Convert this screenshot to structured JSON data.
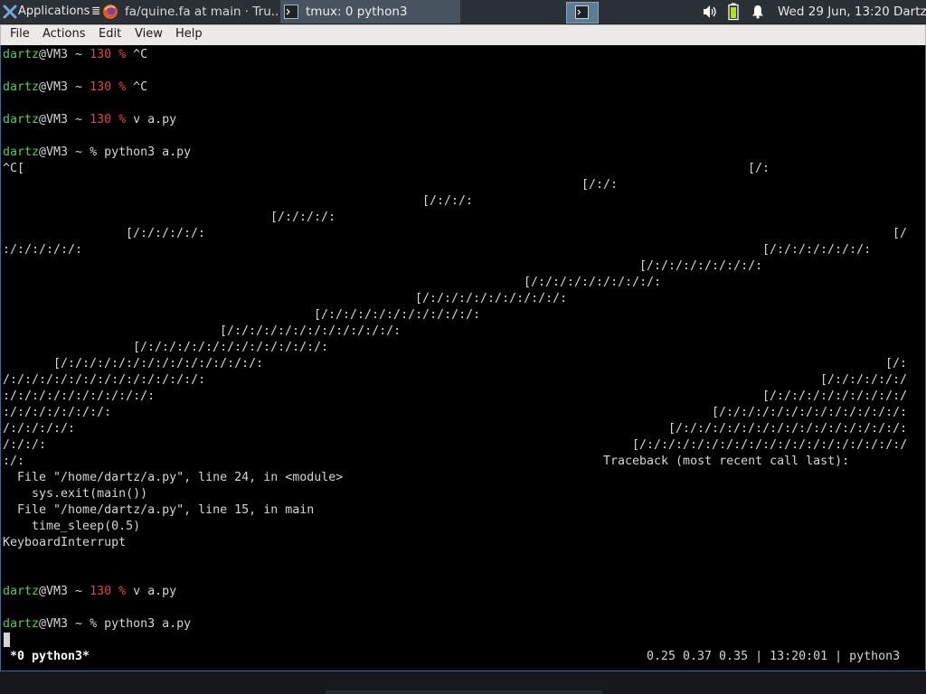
{
  "panel": {
    "apps_label": "Applications",
    "apps_suffix": "≣",
    "tasks": [
      {
        "label": "fa/quine.fa at main · Tru..."
      },
      {
        "label": "tmux: 0 python3"
      }
    ],
    "clock": "Wed 29 Jun, 13:20",
    "user": "Dartz"
  },
  "menu": {
    "items": [
      "File",
      "Actions",
      "Edit",
      "View",
      "Help"
    ]
  },
  "terminal": {
    "user": "dartz",
    "host": "@VM3 ~ ",
    "exit_code": "130",
    "pct": " %",
    "percent": "%",
    "lines": {
      "c1": " ^C",
      "c2": " ^C",
      "c3": " v a.py",
      "c4": " python3 a.py",
      "l_ctrl": "^C[",
      "r1": "[/:",
      "r2": "[/:/:",
      "r3": "[/:/:/:",
      "r4": "[/:/:/:/:",
      "r5": "[/:/:/:/:/:",
      "r5b": "[/",
      "r6a": ":/:/:/:/:/:",
      "r6b": "[/:/:/:/:/:/:/:",
      "r7": "[/:/:/:/:/:/:/:/:",
      "r8": "[/:/:/:/:/:/:/:/:/:",
      "r9": "[/:/:/:/:/:/:/:/:/:/:",
      "r10": "[/:/:/:/:/:/:/:/:/:/:/:",
      "r11": "[/:/:/:/:/:/:/:/:/:/:/:/:",
      "r12": "[/:/:/:/:/:/:/:/:/:/:/:/:/:",
      "r13": "[/:/:/:/:/:/:/:/:/:/:/:/:/:/:",
      "r13b": "[/:",
      "r14a": "/:/:/:/:/:/:/:/:/:/:/:/:/:/:",
      "r14b": "[/:/:/:/:/:/",
      "r15a": ":/:/:/:/:/:/:/:/:/:/:",
      "r15b": "[/:/:/:/:/:/:/:/:/:/",
      "r16a": ":/:/:/:/:/:/:/:",
      "r16b": "[/:/:/:/:/:/:/:/:/:/:/:/:/:",
      "r17a": "/:/:/:/:/:",
      "r17b": "[/:/:/:/:/:/:/:/:/:/:/:/:/:/:/:/:",
      "r18a": "/:/:/:",
      "r18b": "[/:/:/:/:/:/:/:/:/:/:/:/:/:/:/:/:/:/:/",
      "r19a": ":/:",
      "r19b": "Traceback (most recent call last):",
      "tb1": "  File \"/home/dartz/a.py\", line 24, in <module>",
      "tb2": "    sys.exit(main())",
      "tb3": "  File \"/home/dartz/a.py\", line 15, in main",
      "tb4": "    time_sleep(0.5)",
      "tb5": "KeyboardInterrupt",
      "c5": " v a.py",
      "c6": " python3 a.py"
    }
  },
  "status": {
    "window": "*0 python3*",
    "right": "0.25 0.37 0.35 | 13:20:01 | python3"
  },
  "colors": {
    "prompt_user": "#5cc75c",
    "exit_code": "#e0454d",
    "text": "#d5d5d5",
    "background": "#000000"
  }
}
